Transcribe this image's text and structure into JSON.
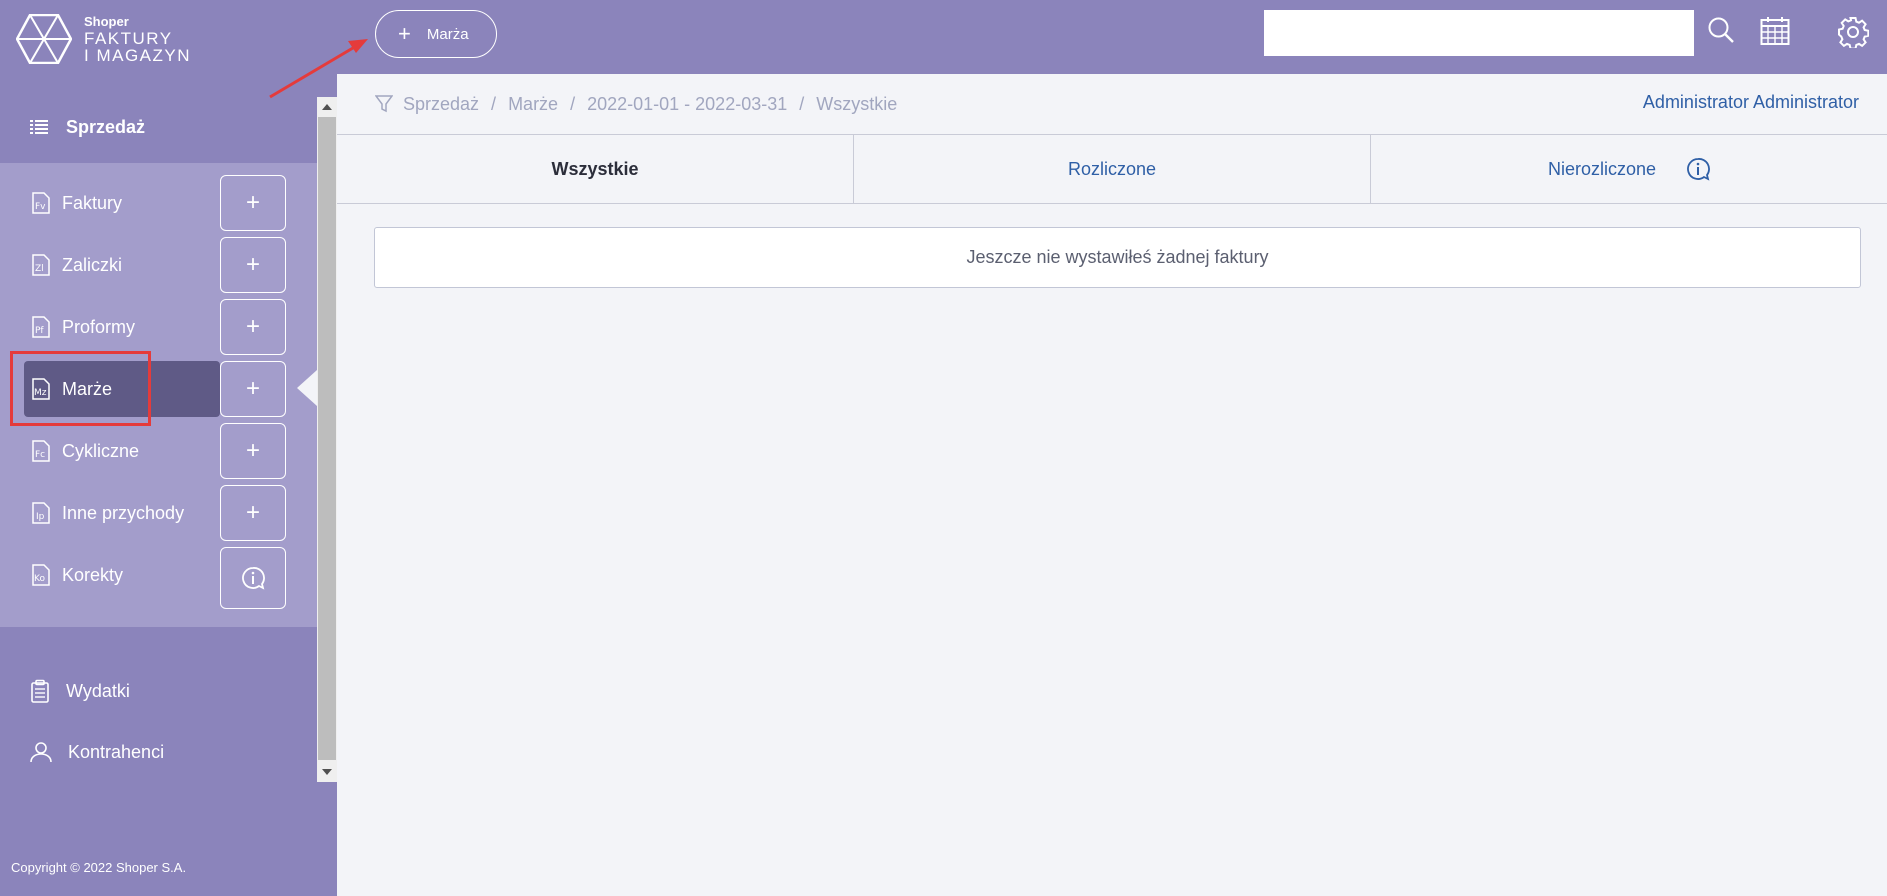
{
  "app": {
    "logo_small": "Shoper",
    "logo_line1": "FAKTURY",
    "logo_line2": "I MAGAZYN"
  },
  "sidebar": {
    "section_title": "Sprzedaż",
    "items": [
      {
        "label": "Faktury",
        "icon": "Fv",
        "action": "+"
      },
      {
        "label": "Zaliczki",
        "icon": "Zl",
        "action": "+"
      },
      {
        "label": "Proformy",
        "icon": "Pf",
        "action": "+"
      },
      {
        "label": "Marże",
        "icon": "Mz",
        "action": "+",
        "active": true
      },
      {
        "label": "Cykliczne",
        "icon": "Fc",
        "action": "+"
      },
      {
        "label": "Inne przychody",
        "icon": "Ip",
        "action": "+"
      },
      {
        "label": "Korekty",
        "icon": "Ko",
        "action": "info-icon"
      }
    ],
    "lower_items": [
      {
        "label": "Wydatki",
        "icon": "clipboard-icon"
      },
      {
        "label": "Kontrahenci",
        "icon": "user-icon"
      }
    ],
    "copyright": "Copyright © 2022 Shoper S.A."
  },
  "topbar": {
    "add_button": {
      "plus": "+",
      "label": "Marża"
    },
    "search_value": "",
    "icons": [
      "search-icon",
      "calendar-icon",
      "gear-icon"
    ]
  },
  "breadcrumb": {
    "items": [
      "Sprzedaż",
      "Marże",
      "2022-01-01 - 2022-03-31",
      "Wszystkie"
    ],
    "separator": "/"
  },
  "user": {
    "name": "Administrator Administrator"
  },
  "tabs": [
    {
      "label": "Wszystkie",
      "active": true
    },
    {
      "label": "Rozliczone"
    },
    {
      "label": "Nierozliczone",
      "icon": "info-icon"
    }
  ],
  "empty_message": "Jeszcze nie wystawiłeś żadnej faktury",
  "colors": {
    "sidebar": "#8b84bb",
    "sidebar_section": "#a39dcb",
    "active_item": "#5f5a86",
    "link": "#2f5fa6",
    "annotation": "#e53b3b"
  }
}
